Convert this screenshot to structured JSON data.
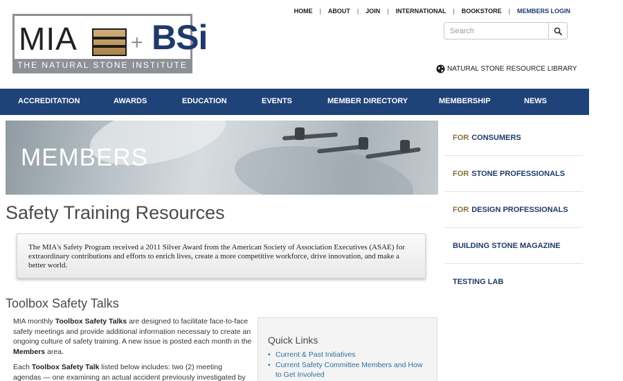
{
  "logo": {
    "left_text": "MIA",
    "plus": "+",
    "right_text": "BSi",
    "tagline": "THE NATURAL STONE INSTITUTE"
  },
  "topnav": {
    "items": [
      "HOME",
      "ABOUT",
      "JOIN",
      "INTERNATIONAL",
      "BOOKSTORE",
      "MEMBERS LOGIN"
    ],
    "separator": "|"
  },
  "search": {
    "placeholder": "Search"
  },
  "library_link": "NATURAL STONE RESOURCE LIBRARY",
  "mainnav": {
    "items": [
      "ACCREDITATION",
      "AWARDS",
      "EDUCATION",
      "EVENTS",
      "MEMBER DIRECTORY",
      "MEMBERSHIP",
      "NEWS"
    ]
  },
  "hero": {
    "title": "MEMBERS"
  },
  "sidebar": {
    "items": [
      {
        "prefix": "FOR",
        "label": "CONSUMERS"
      },
      {
        "prefix": "FOR",
        "label": "STONE PROFESSIONALS"
      },
      {
        "prefix": "FOR",
        "label": "DESIGN PROFESSIONALS"
      },
      {
        "prefix": "",
        "label": "BUILDING STONE MAGAZINE"
      },
      {
        "prefix": "",
        "label": "TESTING LAB"
      }
    ]
  },
  "content": {
    "title": "Safety Training Resources",
    "award_text": "The MIA's Safety Program received a 2011 Silver Award from the American Society of Association Executives (ASAE) for extraordinary contributions and efforts to enrich lives, create a more competitive workforce, drive innovation, and make a better world.",
    "section_title": "Toolbox Safety Talks",
    "p1_a": "MIA monthly ",
    "p1_b": "Toolbox Safety Talks",
    "p1_c": " are designed to facilitate face-to-face safety meetings and provide additional information necessary to create an ongoing culture of safety training. A new issue is posted each month in the ",
    "p1_d": "Members",
    "p1_e": " area.",
    "p2_a": "Each ",
    "p2_b": "Toolbox Safety Talk",
    "p2_c": " listed below includes: two (2) meeting agendas — one examining an actual accident previously investigated by"
  },
  "quick_links": {
    "title": "Quick Links",
    "links": [
      "Current & Past Initiatives",
      "Current Safety Committee Members and How to Get Involved"
    ]
  },
  "colors": {
    "nav_bg": "#1f4278",
    "brand_blue": "#1f3a68",
    "prefix_gold": "#8b6d3f",
    "link_blue": "#2f6f9e"
  }
}
